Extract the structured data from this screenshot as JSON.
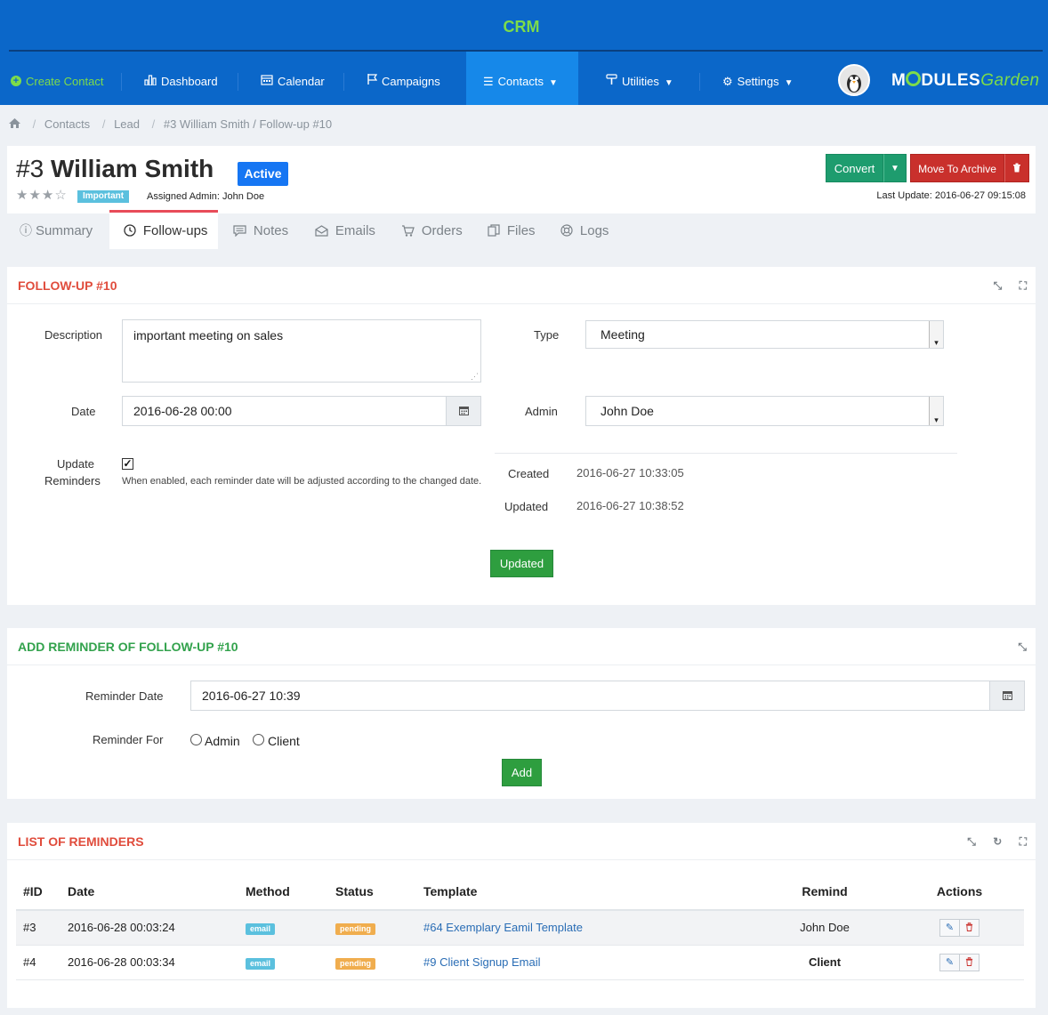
{
  "app": {
    "title": "CRM"
  },
  "nav": {
    "create_contact": "Create Contact",
    "items": [
      {
        "label": "Dashboard",
        "icon": "bar-chart-icon"
      },
      {
        "label": "Calendar",
        "icon": "calendar-icon"
      },
      {
        "label": "Campaigns",
        "icon": "flag-icon"
      },
      {
        "label": "Contacts",
        "icon": "list-icon",
        "active": true
      },
      {
        "label": "Utilities",
        "icon": "tools-icon"
      },
      {
        "label": "Settings",
        "icon": "gear-icon"
      }
    ],
    "brand": {
      "part1": "M",
      "part2": "DULES",
      "part3": "Garden"
    }
  },
  "breadcrumb": {
    "items": [
      "Contacts",
      "Lead",
      "#3 William Smith / Follow-up #10"
    ]
  },
  "contact": {
    "number": "#3",
    "name": "William Smith",
    "status": "Active",
    "rating": "3 of 5 stars",
    "priority": "Important",
    "assigned_admin": "Assigned Admin: John Doe",
    "convert_label": "Convert",
    "archive_label": "Move To Archive",
    "last_update": "Last Update: 2016-06-27 09:15:08"
  },
  "tabs": [
    {
      "label": "Summary",
      "icon": "info-icon"
    },
    {
      "label": "Follow-ups",
      "icon": "clock-icon",
      "active": true
    },
    {
      "label": "Notes",
      "icon": "comment-icon"
    },
    {
      "label": "Emails",
      "icon": "envelope-icon"
    },
    {
      "label": "Orders",
      "icon": "cart-icon"
    },
    {
      "label": "Files",
      "icon": "files-icon"
    },
    {
      "label": "Logs",
      "icon": "lifebuoy-icon"
    }
  ],
  "followup": {
    "title": "FOLLOW-UP #10",
    "description_label": "Description",
    "description_value": "important meeting on sales",
    "type_label": "Type",
    "type_value": "Meeting",
    "date_label": "Date",
    "date_value": "2016-06-28 00:00",
    "admin_label": "Admin",
    "admin_value": "John Doe",
    "update_label_1": "Update",
    "update_label_2": "Reminders",
    "update_checked": true,
    "update_help": "When enabled, each reminder date will be adjusted according to the changed date.",
    "created_label": "Created",
    "created_value": "2016-06-27 10:33:05",
    "updated_label": "Updated",
    "updated_value": "2016-06-27 10:38:52",
    "submit_label": "Updated"
  },
  "add_reminder": {
    "title": "ADD REMINDER OF FOLLOW-UP #10",
    "date_label": "Reminder Date",
    "date_value": "2016-06-27 10:39",
    "for_label": "Reminder For",
    "option_admin": "Admin",
    "option_client": "Client",
    "submit_label": "Add"
  },
  "reminders": {
    "title": "LIST OF REMINDERS",
    "columns": [
      "#ID",
      "Date",
      "Method",
      "Status",
      "Template",
      "Remind",
      "Actions"
    ],
    "rows": [
      {
        "id": "#3",
        "date": "2016-06-28 00:03:24",
        "method": "email",
        "status": "pending",
        "template": "#64 Exemplary Eamil Template",
        "remind": "John Doe"
      },
      {
        "id": "#4",
        "date": "2016-06-28 00:03:34",
        "method": "email",
        "status": "pending",
        "template": "#9 Client Signup Email",
        "remind": "Client"
      }
    ]
  },
  "colors": {
    "header_bg": "#0b67c9",
    "nav_active": "#1688e9",
    "accent_green": "#7ddc4a",
    "title_red": "#e04c3c",
    "title_green": "#32a24c",
    "status_blue": "#1676f3"
  }
}
